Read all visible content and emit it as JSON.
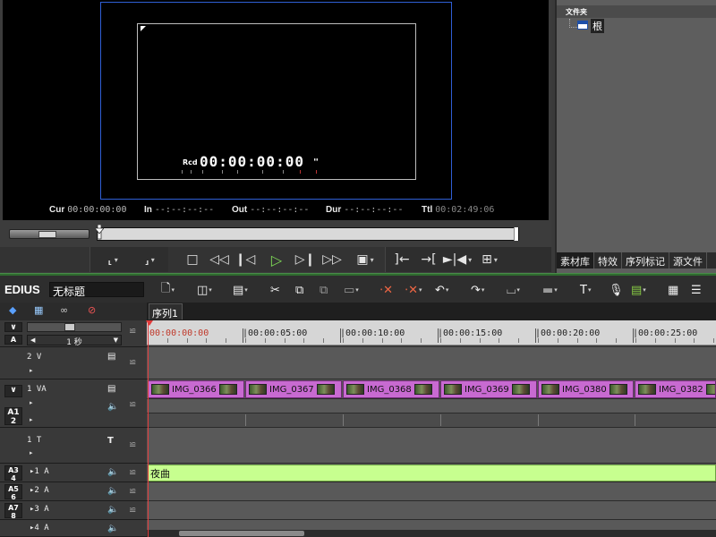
{
  "preview": {
    "record_label": "Rcd",
    "record_timecode": "00:00:00:00",
    "pause_mark": "\"",
    "timecodes": [
      {
        "label": "Cur",
        "value": "00:00:00:00"
      },
      {
        "label": "In",
        "value": "--:--:--:--"
      },
      {
        "label": "Out",
        "value": "--:--:--:--"
      },
      {
        "label": "Dur",
        "value": "--:--:--:--"
      },
      {
        "label": "Ttl",
        "value": "00:02:49:06"
      }
    ]
  },
  "bin": {
    "title": "文件夹",
    "root_label": "根",
    "tabs": [
      "素材库",
      "特效",
      "序列标记",
      "源文件"
    ]
  },
  "toolbar": {
    "brand": "EDIUS",
    "project_name": "无标题"
  },
  "timeline": {
    "sequence_tab": "序列1",
    "zoom_label": "1 秒",
    "ruler_labels": [
      "00:00:00:00",
      "|00:00:05:00",
      "|00:00:10:00",
      "|00:00:15:00",
      "|00:00:20:00",
      "|00:00:25:00"
    ],
    "tracks": {
      "v2": "2 V",
      "va1": "1 VA",
      "t1": "1 T",
      "a1": "1 A",
      "a2": "2 A",
      "a3": "3 A",
      "a4": "4 A"
    },
    "patch_labels": {
      "a12": "A1 2",
      "a34": "A3 4",
      "a56": "A5 6",
      "a78": "A7 8",
      "a": "A"
    },
    "clips": [
      "IMG_0366",
      "IMG_0367",
      "IMG_0368",
      "IMG_0369",
      "IMG_0380",
      "IMG_0382"
    ],
    "audio_clip": "夜曲"
  },
  "colors": {
    "safe_frame": "#2f5fd6",
    "video_clip": "#c86ad1",
    "audio_clip": "#c7ff8f",
    "cursor": "#e23b3b",
    "play_button": "#7ed957"
  }
}
